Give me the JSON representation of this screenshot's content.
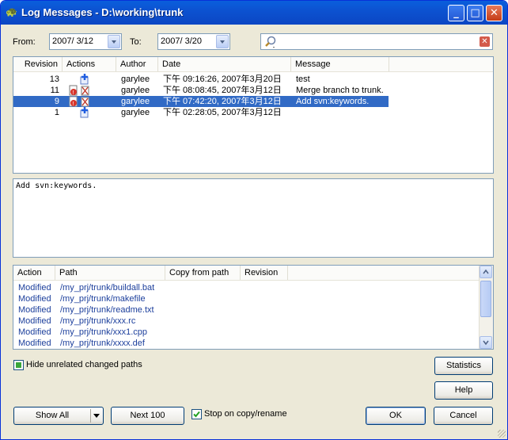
{
  "window": {
    "title": "Log Messages - D:\\working\\trunk"
  },
  "filters": {
    "from_label": "From:",
    "from_value": "2007/  3/12",
    "to_label": "To:",
    "to_value": "2007/  3/20",
    "search_value": ""
  },
  "log_table": {
    "columns": [
      "Revision",
      "Actions",
      "Author",
      "Date",
      "Message"
    ],
    "rows": [
      {
        "revision": "13",
        "actions": [
          "add"
        ],
        "author": "garylee",
        "date": "下午 09:16:26, 2007年3月20日",
        "message": "test"
      },
      {
        "revision": "11",
        "actions": [
          "modify",
          "delete"
        ],
        "author": "garylee",
        "date": "下午 08:08:45, 2007年3月12日",
        "message": "Merge branch to trunk."
      },
      {
        "revision": "9",
        "actions": [
          "modify",
          "delete"
        ],
        "author": "garylee",
        "date": "下午 07:42:20, 2007年3月12日",
        "message": "Add svn:keywords.",
        "selected": true
      },
      {
        "revision": "1",
        "actions": [
          "add"
        ],
        "author": "garylee",
        "date": "下午 02:28:05, 2007年3月12日",
        "message": ""
      }
    ]
  },
  "message_text": "Add svn:keywords.",
  "paths_table": {
    "columns": [
      "Action",
      "Path",
      "Copy from path",
      "Revision"
    ],
    "rows": [
      {
        "action": "Modified",
        "path": "/my_prj/trunk/buildall.bat"
      },
      {
        "action": "Modified",
        "path": "/my_prj/trunk/makefile"
      },
      {
        "action": "Modified",
        "path": "/my_prj/trunk/readme.txt"
      },
      {
        "action": "Modified",
        "path": "/my_prj/trunk/xxx.rc"
      },
      {
        "action": "Modified",
        "path": "/my_prj/trunk/xxx1.cpp"
      },
      {
        "action": "Modified",
        "path": "/my_prj/trunk/xxxx.def"
      }
    ]
  },
  "options": {
    "hide_unrelated_label": "Hide unrelated changed paths",
    "stop_on_copy_label": "Stop on copy/rename"
  },
  "buttons": {
    "statistics": "Statistics",
    "help": "Help",
    "show_all": "Show All",
    "next_100": "Next 100",
    "ok": "OK",
    "cancel": "Cancel"
  },
  "colors": {
    "selection": "#316ac5",
    "path_text": "#1c3f9c",
    "title_bar": "#0b52d1"
  }
}
